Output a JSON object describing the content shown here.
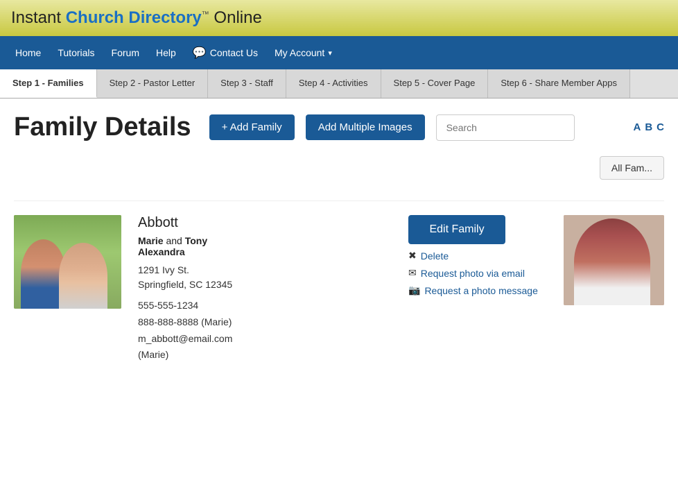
{
  "header": {
    "logo_plain": "Instant ",
    "logo_church": "Church Directory",
    "logo_tm": "™",
    "logo_online": " Online"
  },
  "nav": {
    "items": [
      {
        "label": "Home",
        "id": "home"
      },
      {
        "label": "Tutorials",
        "id": "tutorials"
      },
      {
        "label": "Forum",
        "id": "forum"
      },
      {
        "label": "Help",
        "id": "help"
      },
      {
        "label": "Contact Us",
        "id": "contact",
        "has_icon": true
      },
      {
        "label": "My Account",
        "id": "my-account",
        "has_dropdown": true
      }
    ]
  },
  "steps": [
    {
      "label": "Step 1 - Families",
      "id": "step1",
      "active": true
    },
    {
      "label": "Step 2 - Pastor Letter",
      "id": "step2"
    },
    {
      "label": "Step 3 - Staff",
      "id": "step3"
    },
    {
      "label": "Step 4 - Activities",
      "id": "step4"
    },
    {
      "label": "Step 5 - Cover Page",
      "id": "step5"
    },
    {
      "label": "Step 6 - Share Member Apps",
      "id": "step6"
    }
  ],
  "page": {
    "title": "Family Details",
    "add_family_btn": "+ Add Family",
    "add_multiple_btn": "Add Multiple Images",
    "search_placeholder": "Search",
    "alpha_links": [
      "A",
      "B",
      "C"
    ],
    "all_families_btn": "All Fam..."
  },
  "family": {
    "name": "Abbott",
    "members": [
      "Marie",
      "Tony",
      "Alexandra"
    ],
    "address_line1": "1291 Ivy St.",
    "address_line2": "Springfield, SC 12345",
    "phone1": "555-555-1234",
    "phone2": "888-888-8888 (Marie)",
    "email": "m_abbott@email.com",
    "email_label": "(Marie)",
    "edit_btn": "Edit Family",
    "delete_label": "Delete",
    "request_photo_email": "Request photo via email",
    "request_photo_msg": "Request a photo message"
  }
}
